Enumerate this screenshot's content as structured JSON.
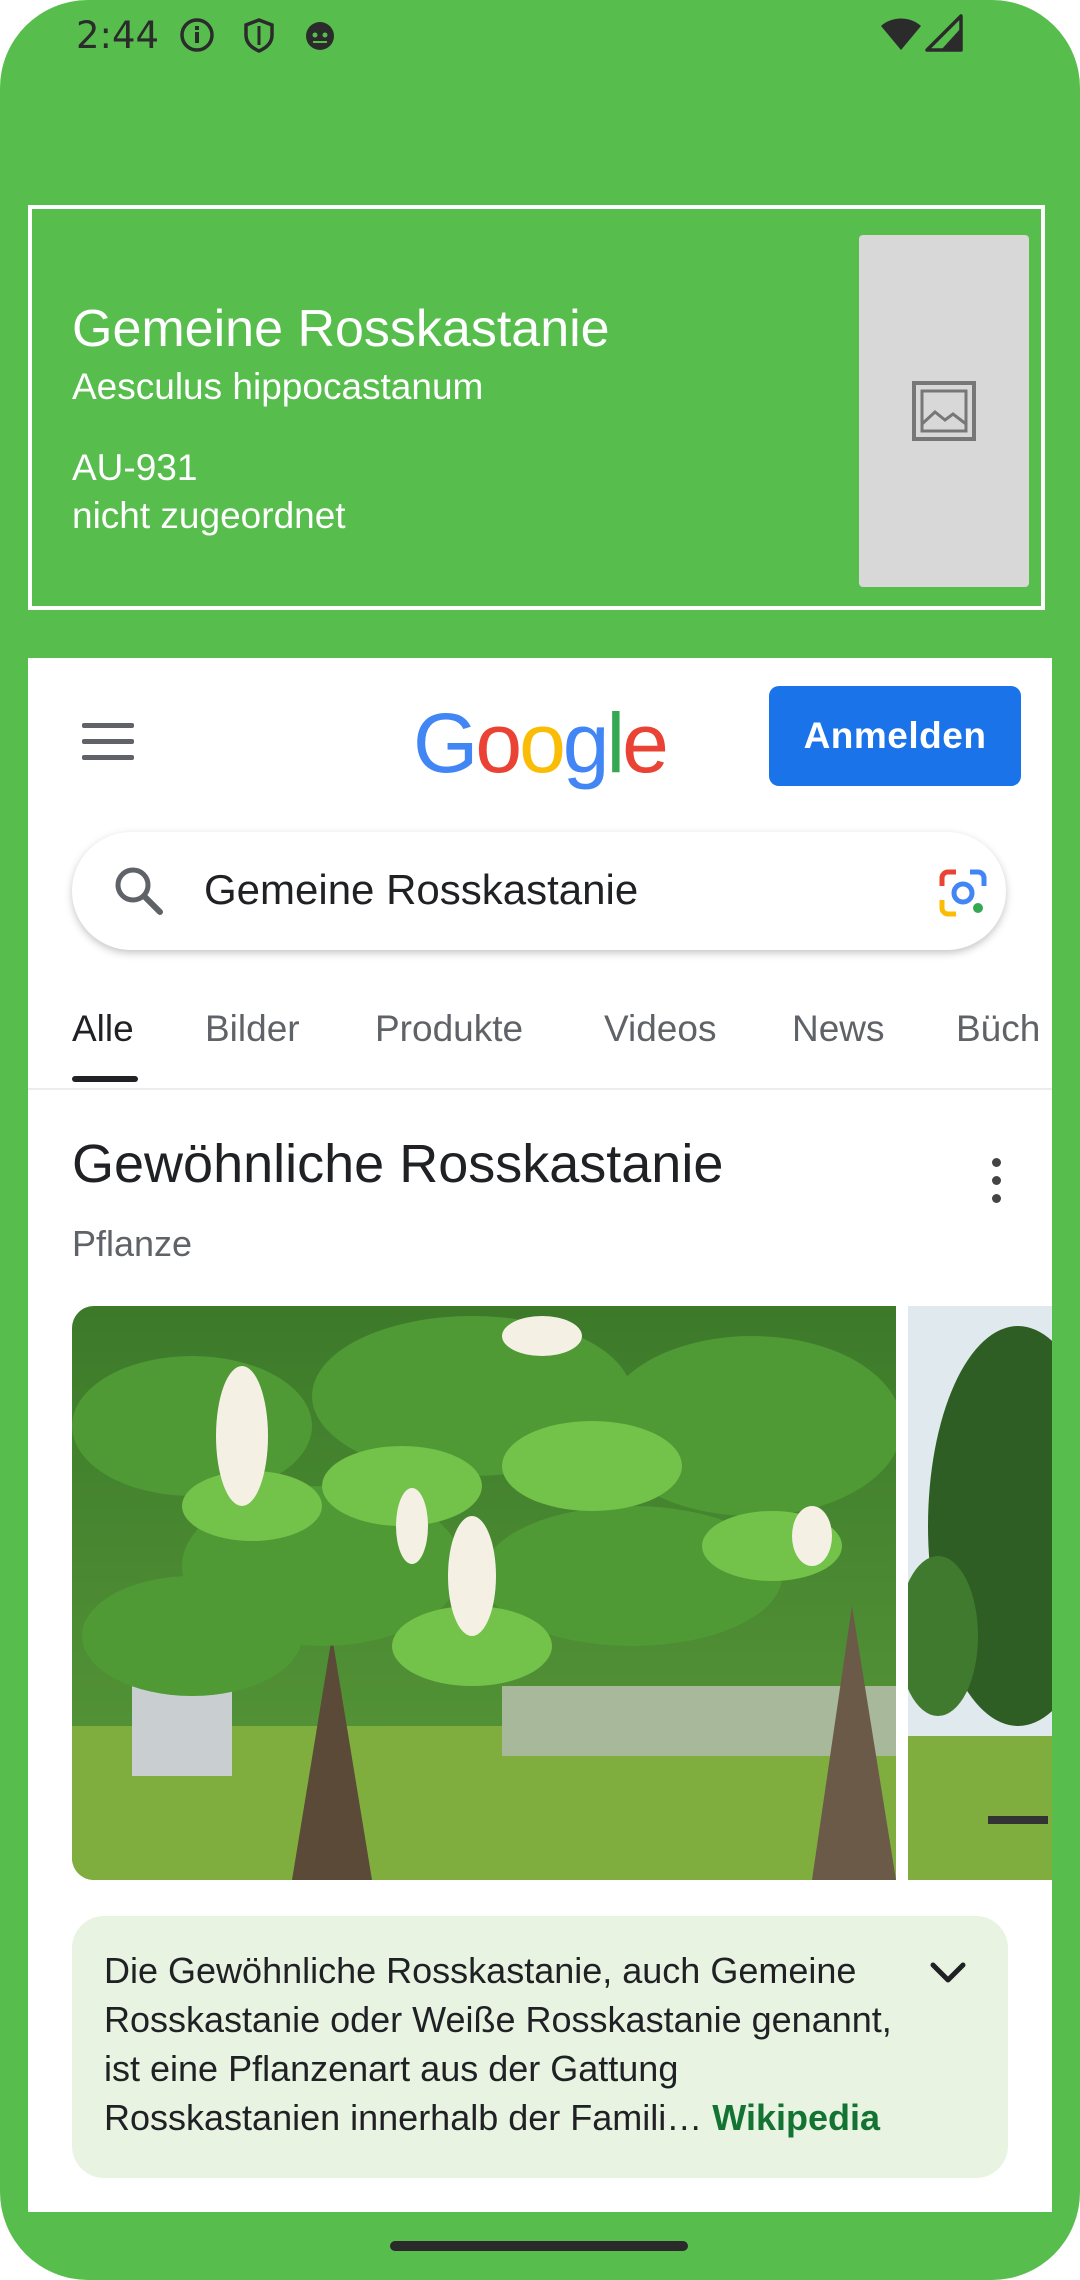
{
  "status_bar": {
    "time": "2:44",
    "icons": [
      "info-icon",
      "shield-icon",
      "android-icon",
      "wifi-icon",
      "signal-icon"
    ]
  },
  "plant_card": {
    "common_name": "Gemeine Rosskastanie",
    "latin_name": "Aesculus hippocastanum",
    "id": "AU-931",
    "assignment": "nicht zugeordnet",
    "thumbnail_icon": "image-placeholder-icon"
  },
  "google": {
    "sign_in_label": "Anmelden",
    "query": "Gemeine Rosskastanie",
    "tabs": [
      {
        "label": "Alle"
      },
      {
        "label": "Bilder"
      },
      {
        "label": "Produkte"
      },
      {
        "label": "Videos"
      },
      {
        "label": "News"
      },
      {
        "label": "Büch"
      }
    ],
    "knowledge_panel": {
      "title": "Gewöhnliche Rosskastanie",
      "subtitle": "Pflanze",
      "description": "Die Gewöhnliche Rosskastanie, auch Gemeine Rosskastanie oder Weiße Rosskastanie genannt, ist eine Pflanzenart aus der Gattung Rosskastanien innerhalb der Famili…",
      "source": "Wikipedia"
    }
  },
  "colors": {
    "background": "#57be4e",
    "google_blue": "#1a73e8",
    "description_bg": "#e8f3e2",
    "wiki_link": "#137333"
  }
}
